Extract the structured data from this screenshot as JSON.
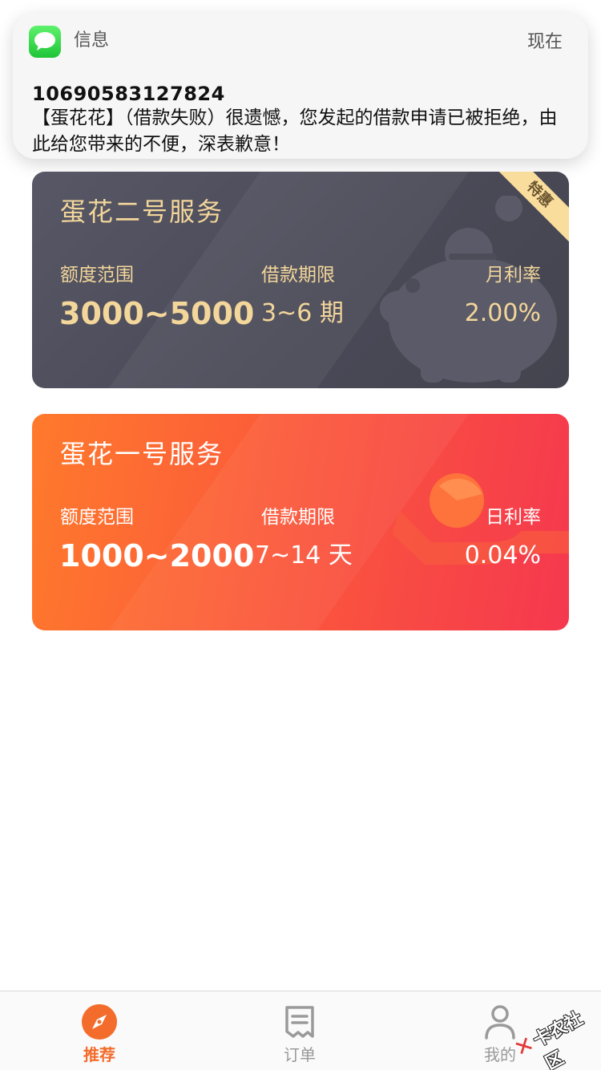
{
  "notification": {
    "app_name": "信息",
    "time": "现在",
    "sender": "10690583127824",
    "message": "【蛋花花】（借款失败）很遗憾，您发起的借款申请已被拒绝，由此给您带来的不便，深表歉意！"
  },
  "cards": [
    {
      "title": "蛋花二号服务",
      "badge": "特惠",
      "range_label": "额度范围",
      "range_value": "3000~5000",
      "term_label": "借款期限",
      "term_value": "3~6 期",
      "rate_label": "月利率",
      "rate_value": "2.00%",
      "deco_icon": "piggy-bank-icon"
    },
    {
      "title": "蛋花一号服务",
      "range_label": "额度范围",
      "range_value": "1000~2000",
      "term_label": "借款期限",
      "term_value": "7~14 天",
      "rate_label": "日利率",
      "rate_value": "0.04%",
      "deco_icon": "hand-coin-icon"
    }
  ],
  "tabbar": {
    "items": [
      {
        "label": "推荐",
        "icon": "compass-icon",
        "active": true
      },
      {
        "label": "订单",
        "icon": "receipt-icon",
        "active": false
      },
      {
        "label": "我的",
        "icon": "user-icon",
        "active": false
      }
    ]
  },
  "watermark": {
    "text": "卡农社区"
  },
  "colors": {
    "accent_orange": "#f36c2b",
    "card_dark": "#4d4d5a",
    "card_gold_text": "#f3d69a",
    "badge_gold": "#f8dd9c",
    "messages_green": "#30d158"
  }
}
